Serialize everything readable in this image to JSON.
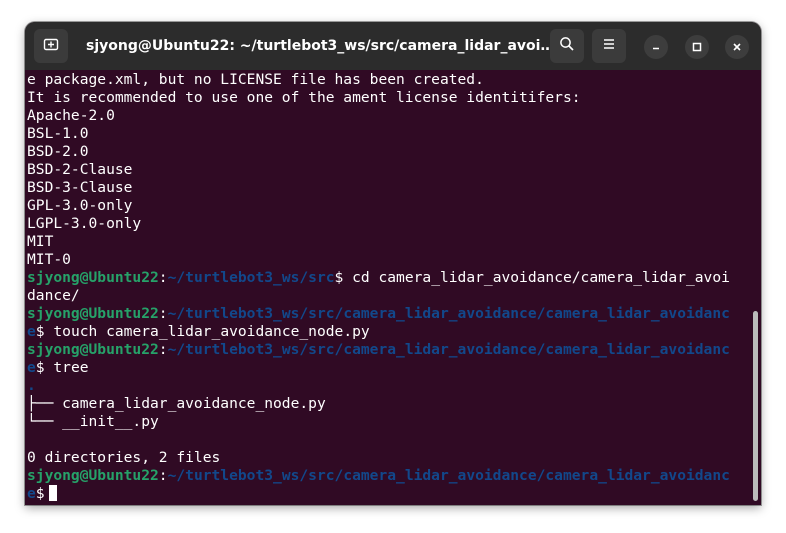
{
  "window": {
    "title": "sjyong@Ubuntu22: ~/turtlebot3_ws/src/camera_lidar_avoida..."
  },
  "icons": {
    "new_tab": "new-tab-icon",
    "search": "search-icon",
    "menu": "hamburger-menu-icon",
    "minimize": "minimize-icon",
    "maximize": "maximize-icon",
    "close": "close-icon"
  },
  "colors": {
    "terminal_bg": "#300a24",
    "user_host": "#26a269",
    "path": "#12488b",
    "titlebar": "#2c2c2c"
  },
  "terminal": {
    "output1": [
      "e package.xml, but no LICENSE file has been created.",
      "It is recommended to use one of the ament license identitifers:",
      "Apache-2.0",
      "BSL-1.0",
      "BSD-2.0",
      "BSD-2-Clause",
      "BSD-3-Clause",
      "GPL-3.0-only",
      "LGPL-3.0-only",
      "MIT",
      "MIT-0"
    ],
    "cmd1": {
      "user": "sjyong@Ubuntu22",
      "sep": ":",
      "path": "~/turtlebot3_ws/src",
      "dollar": "$",
      "command": " cd camera_lidar_avoidance/camera_lidar_avoi",
      "wrap": "dance/"
    },
    "cmd2": {
      "user": "sjyong@Ubuntu22",
      "sep": ":",
      "path": "~/turtlebot3_ws/src/camera_lidar_avoidance/camera_lidar_avoidanc",
      "path_wrap": "e",
      "dollar": "$",
      "command": " touch camera_lidar_avoidance_node.py"
    },
    "cmd3": {
      "user": "sjyong@Ubuntu22",
      "sep": ":",
      "path": "~/turtlebot3_ws/src/camera_lidar_avoidance/camera_lidar_avoidanc",
      "path_wrap": "e",
      "dollar": "$",
      "command": " tree"
    },
    "tree_root": ".",
    "tree_items": [
      "├── camera_lidar_avoidance_node.py",
      "└── __init__.py"
    ],
    "tree_summary": "0 directories, 2 files",
    "cmd4": {
      "user": "sjyong@Ubuntu22",
      "sep": ":",
      "path": "~/turtlebot3_ws/src/camera_lidar_avoidance/camera_lidar_avoidanc",
      "path_wrap": "e",
      "dollar": "$"
    }
  }
}
